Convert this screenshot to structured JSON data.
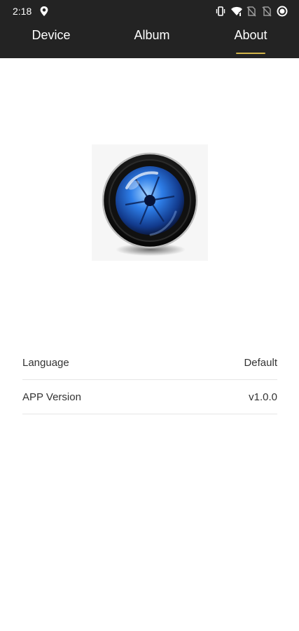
{
  "status_bar": {
    "time": "2:18",
    "left_icon": "location-pin-icon",
    "right_icons": [
      "vibrate-icon",
      "wifi-icon",
      "no-sim-icon",
      "no-sim-icon",
      "record-icon"
    ]
  },
  "tabs": [
    {
      "label": "Device",
      "active": false
    },
    {
      "label": "Album",
      "active": false
    },
    {
      "label": "About",
      "active": true
    }
  ],
  "colors": {
    "topbar": "#232323",
    "accent": "#d1b44a",
    "text": "#333333",
    "divider": "#e6e6e6"
  },
  "about": {
    "logo_icon": "camera-lens-icon",
    "rows": [
      {
        "label": "Language",
        "value": "Default"
      },
      {
        "label": "APP Version",
        "value": "v1.0.0"
      }
    ]
  }
}
